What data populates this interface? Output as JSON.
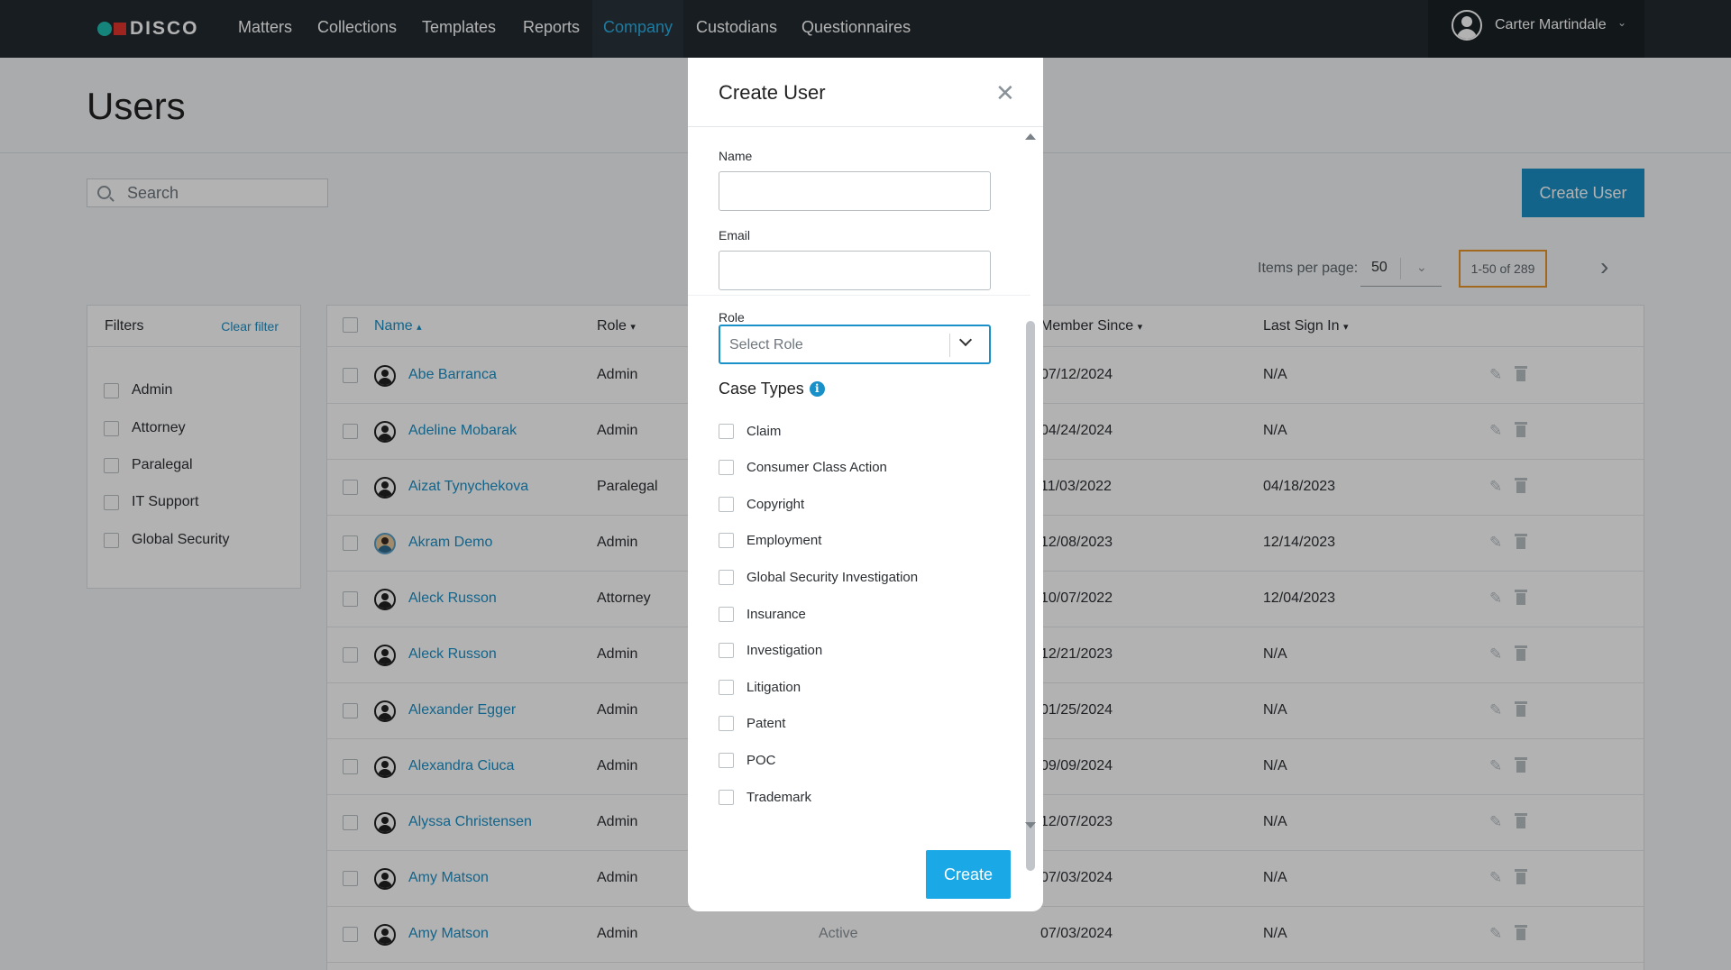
{
  "brand": {
    "name": "DISCO"
  },
  "nav": {
    "items": [
      {
        "label": "Matters",
        "active": false
      },
      {
        "label": "Collections",
        "active": false
      },
      {
        "label": "Templates",
        "active": false
      },
      {
        "label": "Reports",
        "active": false
      },
      {
        "label": "Company",
        "active": true
      },
      {
        "label": "Custodians",
        "active": false
      },
      {
        "label": "Questionnaires",
        "active": false
      }
    ],
    "user_name": "Carter Martindale"
  },
  "page": {
    "title": "Users",
    "search_placeholder": "Search",
    "create_user_label": "Create User",
    "items_per_page_label": "Items per page:",
    "items_per_page": "50",
    "range": "1-50 of 289"
  },
  "filters": {
    "title": "Filters",
    "clear_label": "Clear filter",
    "options": [
      "Admin",
      "Attorney",
      "Paralegal",
      "IT Support",
      "Global Security"
    ]
  },
  "table": {
    "columns": {
      "name": "Name",
      "role": "Role",
      "member_since": "Member Since",
      "last_sign_in": "Last Sign In"
    },
    "rows": [
      {
        "name": "Abe Barranca",
        "role": "Admin",
        "status": "",
        "member_since": "07/12/2024",
        "last_sign_in": "N/A",
        "avatar": "default"
      },
      {
        "name": "Adeline Mobarak",
        "role": "Admin",
        "status": "",
        "member_since": "04/24/2024",
        "last_sign_in": "N/A",
        "avatar": "default"
      },
      {
        "name": "Aizat Tynychekova",
        "role": "Paralegal",
        "status": "",
        "member_since": "11/03/2022",
        "last_sign_in": "04/18/2023",
        "avatar": "default"
      },
      {
        "name": "Akram Demo",
        "role": "Admin",
        "status": "",
        "member_since": "12/08/2023",
        "last_sign_in": "12/14/2023",
        "avatar": "photo"
      },
      {
        "name": "Aleck Russon",
        "role": "Attorney",
        "status": "",
        "member_since": "10/07/2022",
        "last_sign_in": "12/04/2023",
        "avatar": "default"
      },
      {
        "name": "Aleck Russon",
        "role": "Admin",
        "status": "",
        "member_since": "12/21/2023",
        "last_sign_in": "N/A",
        "avatar": "default"
      },
      {
        "name": "Alexander Egger",
        "role": "Admin",
        "status": "",
        "member_since": "01/25/2024",
        "last_sign_in": "N/A",
        "avatar": "default"
      },
      {
        "name": "Alexandra Ciuca",
        "role": "Admin",
        "status": "",
        "member_since": "09/09/2024",
        "last_sign_in": "N/A",
        "avatar": "default"
      },
      {
        "name": "Alyssa Christensen",
        "role": "Admin",
        "status": "",
        "member_since": "12/07/2023",
        "last_sign_in": "N/A",
        "avatar": "default"
      },
      {
        "name": "Amy Matson",
        "role": "Admin",
        "status": "",
        "member_since": "07/03/2024",
        "last_sign_in": "N/A",
        "avatar": "default"
      },
      {
        "name": "Amy Matson",
        "role": "Admin",
        "status": "Active",
        "member_since": "07/03/2024",
        "last_sign_in": "N/A",
        "avatar": "default"
      }
    ]
  },
  "modal": {
    "title": "Create User",
    "name_label": "Name",
    "name_value": "",
    "email_label": "Email",
    "email_value": "",
    "role_label": "Role",
    "role_placeholder": "Select Role",
    "case_types_label": "Case Types",
    "case_types": [
      "Claim",
      "Consumer Class Action",
      "Copyright",
      "Employment",
      "Global Security Investigation",
      "Insurance",
      "Investigation",
      "Litigation",
      "Patent",
      "POC",
      "Trademark"
    ],
    "create_label": "Create"
  },
  "colors": {
    "nav_bg": "#232a30",
    "accent": "#1a90c8",
    "active_nav": "#2ab0e8",
    "create_button": "#1aa8e6",
    "pager_highlight": "#e8962a"
  }
}
